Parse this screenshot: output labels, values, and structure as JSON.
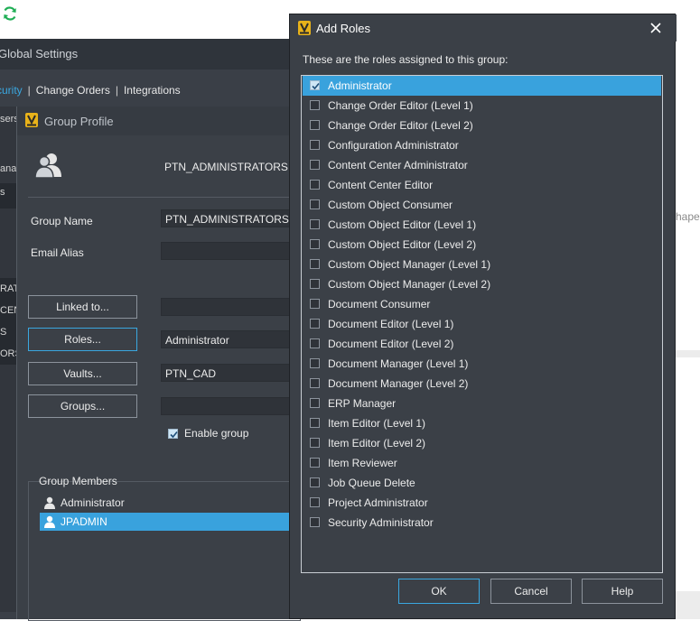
{
  "background": {
    "partial_text": "hape"
  },
  "global_settings": {
    "title": "Global Settings",
    "tabs": [
      {
        "label": "curity",
        "active": true
      },
      {
        "label": "Change Orders",
        "active": false
      },
      {
        "label": "Integrations",
        "active": false
      }
    ],
    "separator": "|",
    "left_fragments": [
      "sers",
      "ana",
      "s",
      "RAT",
      "CEN",
      "S",
      "ORS"
    ]
  },
  "group_profile": {
    "title": "Group Profile",
    "group_name_display": "PTN_ADMINISTRATORS",
    "group_name_label": "Group Name",
    "group_name_value": "PTN_ADMINISTRATORS",
    "email_alias_label": "Email Alias",
    "email_alias_value": "",
    "buttons": {
      "linked": "Linked to...",
      "roles": "Roles...",
      "vaults": "Vaults...",
      "groups": "Groups..."
    },
    "linked_value": "",
    "roles_value": "Administrator",
    "vaults_value": "PTN_CAD",
    "groups_value": "",
    "enable_group_label": "Enable group",
    "enable_group_checked": true,
    "members_label": "Group Members",
    "members": [
      {
        "name": "Administrator",
        "selected": false
      },
      {
        "name": "JPADMIN",
        "selected": true
      }
    ]
  },
  "add_roles": {
    "title": "Add Roles",
    "caption": "These are the roles assigned to this group:",
    "roles": [
      {
        "label": "Administrator",
        "checked": true,
        "selected": true
      },
      {
        "label": "Change Order Editor (Level 1)",
        "checked": false,
        "selected": false
      },
      {
        "label": "Change Order Editor (Level 2)",
        "checked": false,
        "selected": false
      },
      {
        "label": "Configuration Administrator",
        "checked": false,
        "selected": false
      },
      {
        "label": "Content Center Administrator",
        "checked": false,
        "selected": false
      },
      {
        "label": "Content Center Editor",
        "checked": false,
        "selected": false
      },
      {
        "label": "Custom Object Consumer",
        "checked": false,
        "selected": false
      },
      {
        "label": "Custom Object Editor (Level 1)",
        "checked": false,
        "selected": false
      },
      {
        "label": "Custom Object Editor (Level 2)",
        "checked": false,
        "selected": false
      },
      {
        "label": "Custom Object Manager (Level 1)",
        "checked": false,
        "selected": false
      },
      {
        "label": "Custom Object Manager (Level 2)",
        "checked": false,
        "selected": false
      },
      {
        "label": "Document Consumer",
        "checked": false,
        "selected": false
      },
      {
        "label": "Document Editor (Level 1)",
        "checked": false,
        "selected": false
      },
      {
        "label": "Document Editor (Level 2)",
        "checked": false,
        "selected": false
      },
      {
        "label": "Document Manager (Level 1)",
        "checked": false,
        "selected": false
      },
      {
        "label": "Document Manager (Level 2)",
        "checked": false,
        "selected": false
      },
      {
        "label": "ERP Manager",
        "checked": false,
        "selected": false
      },
      {
        "label": "Item Editor (Level 1)",
        "checked": false,
        "selected": false
      },
      {
        "label": "Item Editor (Level 2)",
        "checked": false,
        "selected": false
      },
      {
        "label": "Item Reviewer",
        "checked": false,
        "selected": false
      },
      {
        "label": "Job Queue Delete",
        "checked": false,
        "selected": false
      },
      {
        "label": "Project Administrator",
        "checked": false,
        "selected": false
      },
      {
        "label": "Security Administrator",
        "checked": false,
        "selected": false
      }
    ],
    "buttons": {
      "ok": "OK",
      "cancel": "Cancel",
      "help": "Help"
    }
  },
  "colors": {
    "accent": "#39a2dd",
    "dialog_bg": "#3b4047",
    "app_icon": "#e8b21a",
    "refresh_icon": "#1fae55"
  },
  "icons": {
    "refresh": "refresh-icon",
    "app": "vault-app-icon",
    "close": "close-icon",
    "group": "users-icon",
    "user": "user-icon",
    "check": "check-icon"
  }
}
